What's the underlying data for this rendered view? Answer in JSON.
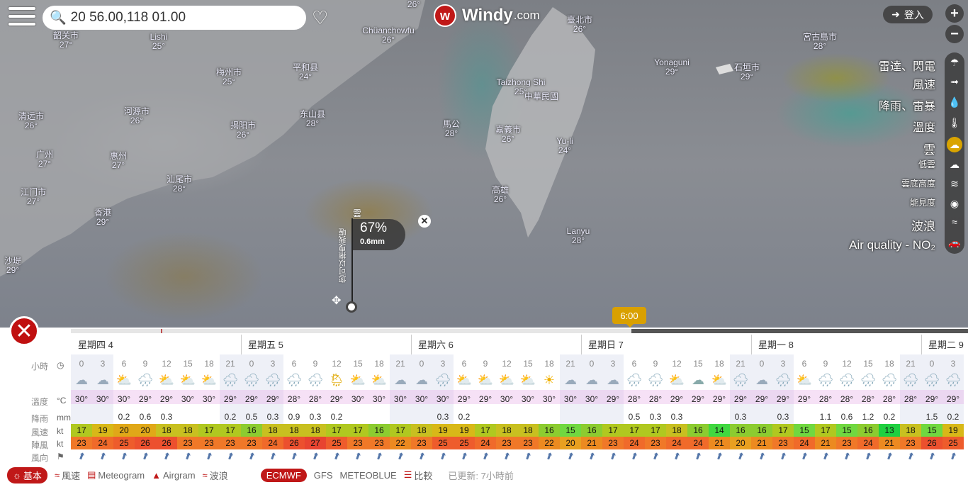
{
  "search": {
    "value": "20 56.00,118 01.00"
  },
  "logo": {
    "word": "Windy",
    "domain": ".com"
  },
  "login": {
    "label": "登入"
  },
  "zoom": {
    "plus": "+",
    "minus": "−"
  },
  "layers": [
    {
      "label": "雷達、閃電",
      "icon": "umbrella-icon"
    },
    {
      "label": "風速",
      "icon": "wind-icon"
    },
    {
      "label": "降雨、雷暴",
      "icon": "drop-icon"
    },
    {
      "label": "溫度",
      "icon": "thermometer-icon"
    },
    {
      "label": "雲",
      "icon": "cloud-icon",
      "active": true
    },
    {
      "label": "低雲",
      "icon": "low-cloud-icon"
    },
    {
      "label": "雲底高度",
      "icon": "cloud-base-icon"
    },
    {
      "label": "能見度",
      "icon": "eye-icon"
    },
    {
      "label": "波浪",
      "icon": "wave-icon"
    },
    {
      "label": "Air quality - NO₂",
      "icon": "car-icon"
    }
  ],
  "cities": [
    {
      "n": "韶关市",
      "t": "27°"
    },
    {
      "n": "Lishi",
      "t": "25°"
    },
    {
      "n": "梅州市",
      "t": "25°"
    },
    {
      "n": "平和县",
      "t": "24°"
    },
    {
      "n": "Chüanchowfu",
      "t": "26°"
    },
    {
      "n": "26°",
      "t": ""
    },
    {
      "n": "臺北市",
      "t": "26°"
    },
    {
      "n": "宮古島市",
      "t": "28°"
    },
    {
      "n": "Yonaguni",
      "t": "29°"
    },
    {
      "n": "石垣市",
      "t": "29°"
    },
    {
      "n": "清远市",
      "t": "26°"
    },
    {
      "n": "河源市",
      "t": "26°"
    },
    {
      "n": "揭阳市",
      "t": "26°"
    },
    {
      "n": "东山县",
      "t": "28°"
    },
    {
      "n": "Taizhong Shi",
      "t": "25°"
    },
    {
      "n": "馬公",
      "t": "28°"
    },
    {
      "n": "嘉義市",
      "t": "26°"
    },
    {
      "n": "Yu-li",
      "t": "24°"
    },
    {
      "n": "广州",
      "t": "27°"
    },
    {
      "n": "惠州",
      "t": "27°"
    },
    {
      "n": "汕尾市",
      "t": "28°"
    },
    {
      "n": "江门市",
      "t": "27°"
    },
    {
      "n": "香港",
      "t": "29°"
    },
    {
      "n": "高雄",
      "t": "26°"
    },
    {
      "n": "Lanyu",
      "t": "28°"
    },
    {
      "n": "沙堤",
      "t": "29°"
    },
    {
      "n": "中華民國",
      "t": ""
    }
  ],
  "popup": {
    "layer": "雲",
    "cover": "67%",
    "rain": "0.6mm",
    "hint": "您可以拖曳我喔",
    "close": "✕"
  },
  "timeline": {
    "bubble": "6:00",
    "position_fraction": 0.625
  },
  "days": [
    "星期四 4",
    "星期五 5",
    "星期六 6",
    "星期日 7",
    "星期一 8",
    "星期二 9"
  ],
  "row_labels": {
    "hours": "小時",
    "temp": "溫度",
    "temp_unit": "°C",
    "rain": "降雨",
    "rain_unit": "mm",
    "wind": "風速",
    "wind_unit": "kt",
    "gust": "陣風",
    "gust_unit": "kt",
    "dir": "風向"
  },
  "hours": [
    "0",
    "3",
    "6",
    "9",
    "12",
    "15",
    "18",
    "21",
    "0",
    "3",
    "6",
    "9",
    "12",
    "15",
    "18",
    "21",
    "0",
    "3",
    "6",
    "9",
    "12",
    "15",
    "18",
    "21",
    "0",
    "3",
    "6",
    "9",
    "12",
    "15",
    "18",
    "21",
    "0",
    "3",
    "6",
    "9",
    "12",
    "15",
    "18",
    "21",
    "0",
    "3"
  ],
  "temps": [
    "30°",
    "30°",
    "30°",
    "29°",
    "29°",
    "30°",
    "30°",
    "29°",
    "29°",
    "29°",
    "28°",
    "28°",
    "29°",
    "30°",
    "30°",
    "30°",
    "30°",
    "30°",
    "29°",
    "29°",
    "30°",
    "30°",
    "30°",
    "30°",
    "30°",
    "29°",
    "28°",
    "28°",
    "29°",
    "29°",
    "29°",
    "29°",
    "29°",
    "29°",
    "29°",
    "28°",
    "28°",
    "28°",
    "28°",
    "28°",
    "29°",
    "29°"
  ],
  "rain": [
    "",
    "",
    "0.2",
    "0.6",
    "0.3",
    "",
    "",
    "0.2",
    "0.5",
    "0.3",
    "0.9",
    "0.3",
    "0.2",
    "",
    "",
    "",
    "",
    "0.3",
    "0.2",
    "",
    "",
    "",
    "",
    "",
    "",
    "",
    "0.5",
    "0.3",
    "0.3",
    "",
    "",
    "0.3",
    "",
    "0.3",
    "",
    "1.1",
    "0.6",
    "1.2",
    "0.2",
    "",
    "1.5",
    "0.2"
  ],
  "wind": [
    17,
    19,
    20,
    20,
    18,
    18,
    17,
    17,
    16,
    18,
    18,
    18,
    17,
    17,
    16,
    17,
    18,
    19,
    19,
    17,
    18,
    18,
    16,
    15,
    16,
    17,
    17,
    17,
    18,
    16,
    14,
    16,
    16,
    17,
    15,
    17,
    15,
    16,
    13,
    18,
    15,
    19
  ],
  "gust": [
    23,
    24,
    25,
    26,
    26,
    23,
    23,
    23,
    23,
    24,
    26,
    27,
    25,
    23,
    23,
    22,
    23,
    25,
    25,
    24,
    23,
    23,
    22,
    20,
    21,
    23,
    24,
    23,
    24,
    24,
    21,
    20,
    21,
    23,
    24,
    21,
    23,
    24,
    21,
    23,
    26,
    25
  ],
  "icons": [
    "night-cloud",
    "night-cloud",
    "sun-cloud",
    "cloud-rain",
    "sun-cloud",
    "sun-cloud",
    "sun-cloud",
    "cloud-rain",
    "cloud-rain",
    "night-rain",
    "cloud-rain",
    "cloud-rain",
    "sun-rain",
    "sun-cloud",
    "sun-cloud",
    "night-cloud",
    "night-cloud",
    "cloud-rain",
    "sun-cloud",
    "sun-cloud",
    "sun-cloud",
    "sun-cloud",
    "sun",
    "night-cloud",
    "night-cloud",
    "night-cloud",
    "cloud-rain",
    "cloud-rain",
    "sun-cloud",
    "cloud",
    "sun-cloud",
    "night-rain",
    "night-cloud",
    "night-rain",
    "sun-cloud",
    "cloud-rain",
    "cloud-rain",
    "cloud-rain",
    "cloud-rain",
    "night-rain",
    "night-rain",
    "night-rain"
  ],
  "footer": {
    "basic": "基本",
    "wind": "風速",
    "meteogram": "Meteogram",
    "airgram": "Airgram",
    "waves": "波浪",
    "ecmwf": "ECMWF",
    "gfs": "GFS",
    "meteoblue": "METEOBLUE",
    "compare": "比較",
    "updated": "已更新: 7小時前"
  },
  "colors": {
    "accent": "#c01818",
    "active_layer": "#d9a400"
  }
}
